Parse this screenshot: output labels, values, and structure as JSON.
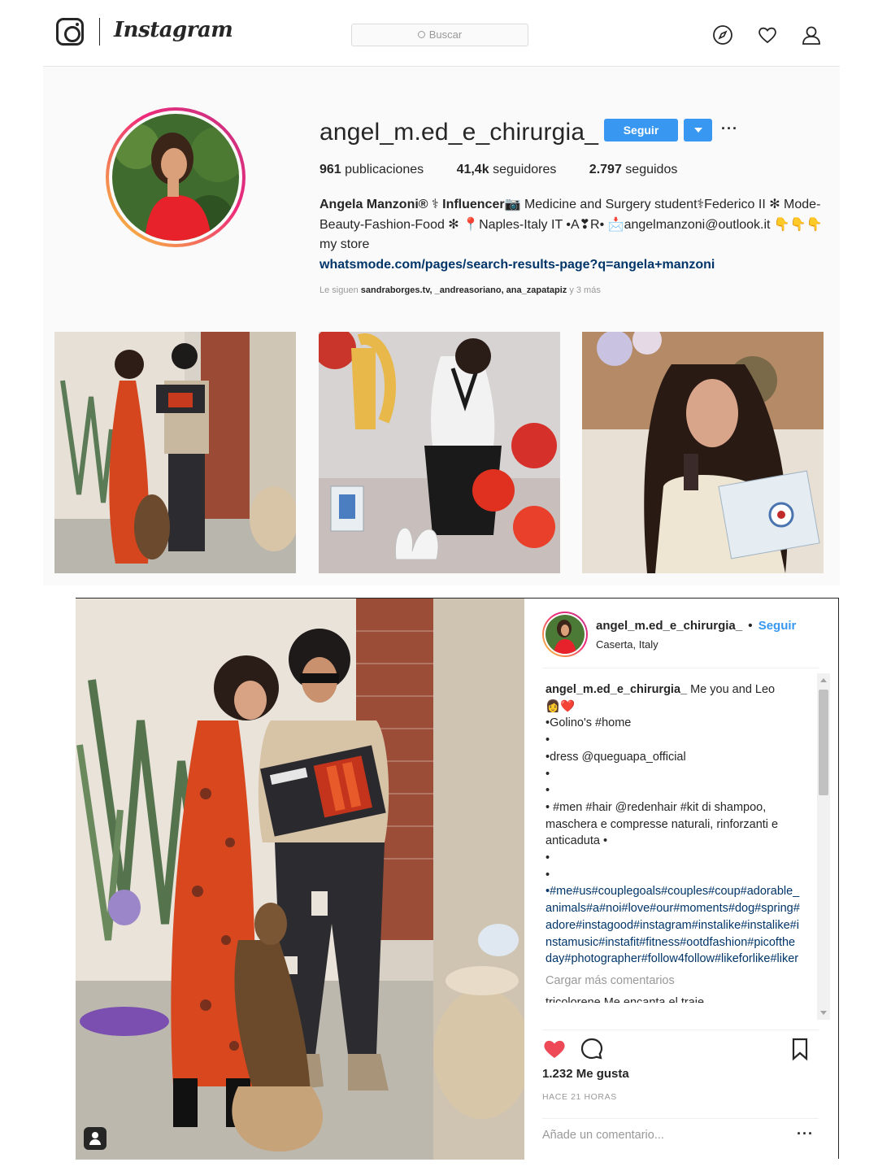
{
  "header": {
    "wordmark": "Instagram",
    "search_placeholder": "Buscar",
    "icons": [
      "instagram-glyph-icon",
      "compass-icon",
      "heart-icon",
      "person-icon"
    ]
  },
  "profile": {
    "username": "angel_m.ed_e_chirurgia_",
    "follow_label": "Seguir",
    "more_label": "···",
    "stats": {
      "posts_value": "961",
      "posts_label": "publicaciones",
      "followers_value": "41,4k",
      "followers_label": "seguidores",
      "following_value": "2.797",
      "following_label": "seguidos"
    },
    "bio": {
      "name": "Angela Manzoni® ⚕ Influencer📷",
      "text": " Medicine and Surgery student⚕Federico II ✻ Mode-Beauty-Fashion-Food ✻ 📍Naples-Italy IT •A❣R• 📩angelmanzoni@outlook.it 👇👇👇 my store",
      "link": "whatsmode.com/pages/search-results-page?q=angela+manzoni"
    },
    "followed_by": {
      "prefix": "Le siguen ",
      "names": "sandraborges.tv, _andreasoriano, ana_zapatapiz",
      "suffix": " y 3 más"
    }
  },
  "post": {
    "username": "angel_m.ed_e_chirurgia_",
    "separator": "•",
    "follow_label": "Seguir",
    "location": "Caserta, Italy",
    "caption_user": "angel_m.ed_e_chirurgia_",
    "caption_first": " Me you and Leo 👩‍❤️",
    "lines": [
      "•Golino's #home",
      "•",
      "•dress @queguapa_official",
      "•",
      "•",
      "• #men #hair @redenhair #kit di shampoo, maschera e compresse naturali, rinforzanti e anticaduta •",
      "•",
      "•",
      "•#me#us#couplegoals#couples#coup#adorable_animals#a#noi#love#our#moments#dog#spring#adore#instagood#instagram#instalike#instalike#instamusic#instafit#fitness#ootdfashion#picoftheday#photographer#follow4follow#likeforlike#liker"
    ],
    "load_more": "Cargar más comentarios",
    "next_comment_peek": "tricolorene Me encanta el traje",
    "likes": "1.232 Me gusta",
    "time": "HACE 21 HORAS",
    "add_comment_placeholder": "Añade un comentario...",
    "more_label": "···"
  },
  "colors": {
    "accent": "#3897f0",
    "link": "#003569",
    "like": "#ed4956",
    "muted": "#999999"
  }
}
